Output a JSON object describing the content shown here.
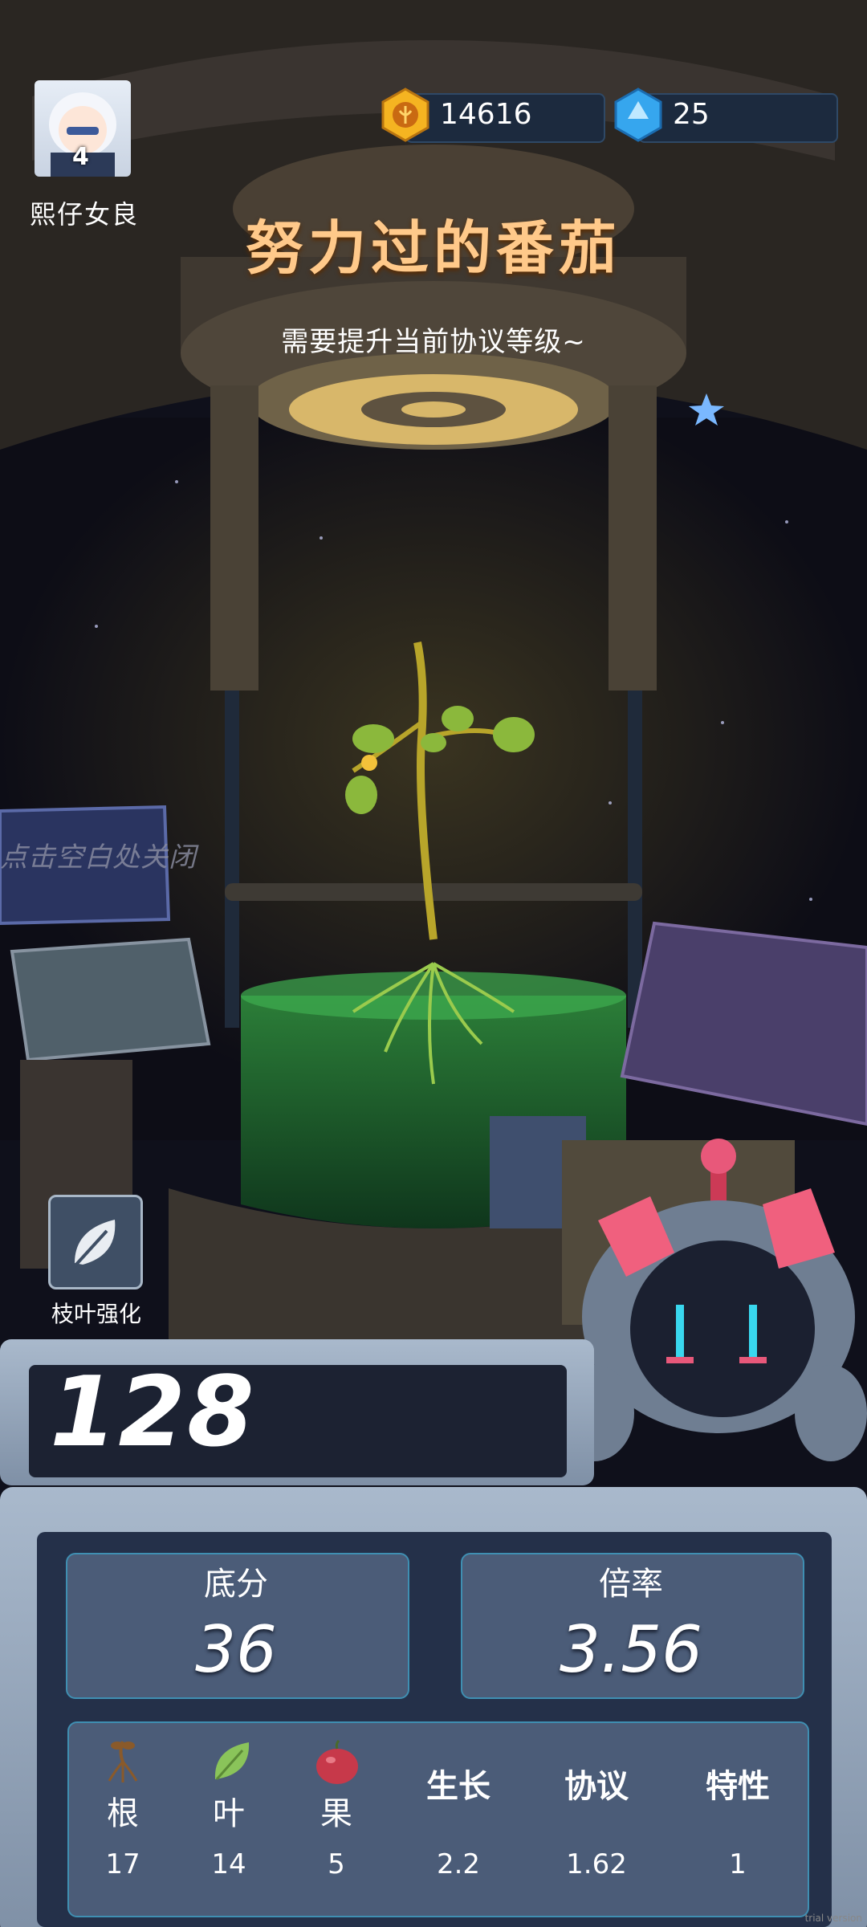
{
  "player": {
    "name": "熙仔女良",
    "level": "4"
  },
  "currency": {
    "coins": "14616",
    "gems": "25"
  },
  "plant": {
    "title": "努力过的番茄",
    "subtitle": "需要提升当前协议等级~"
  },
  "hint": {
    "close": "点击空白处关闭"
  },
  "skill": {
    "label": "枝叶强化"
  },
  "score": {
    "total": "128",
    "base_label": "底分",
    "base_value": "36",
    "mult_label": "倍率",
    "mult_value": "3.56"
  },
  "breakdown": [
    {
      "label": "根",
      "value": "17",
      "icon": "root-icon"
    },
    {
      "label": "叶",
      "value": "14",
      "icon": "leaf-icon"
    },
    {
      "label": "果",
      "value": "5",
      "icon": "fruit-icon"
    },
    {
      "label": "生长",
      "value": "2.2"
    },
    {
      "label": "协议",
      "value": "1.62"
    },
    {
      "label": "特性",
      "value": "1"
    }
  ],
  "watermark": "trial version",
  "colors": {
    "title": "#ffc98a",
    "panel": "#4b5c78",
    "panel_border": "#3f8fb2",
    "coin": "#f5b421",
    "gem": "#36a6ee"
  }
}
